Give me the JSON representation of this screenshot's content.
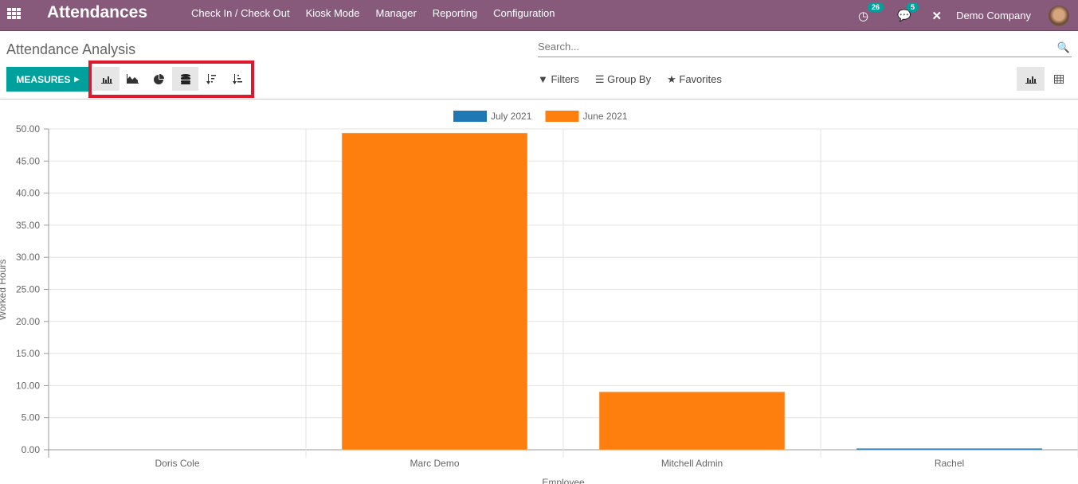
{
  "navbar": {
    "app_title": "Attendances",
    "menu": [
      "Check In / Check Out",
      "Kiosk Mode",
      "Manager",
      "Reporting",
      "Configuration"
    ],
    "activity_count": "26",
    "message_count": "5",
    "company": "Demo Company"
  },
  "control_panel": {
    "breadcrumb": "Attendance Analysis",
    "search_placeholder": "Search...",
    "measures_label": "MEASURES",
    "filters_label": "Filters",
    "groupby_label": "Group By",
    "favorites_label": "Favorites"
  },
  "colors": {
    "navbar": "#875a7b",
    "primary": "#00a09d",
    "highlight": "#e0182d"
  },
  "chart_data": {
    "type": "bar",
    "stacked": true,
    "categories": [
      "Doris Cole",
      "Marc Demo",
      "Mitchell Admin",
      "Rachel"
    ],
    "series": [
      {
        "name": "July 2021",
        "color": "#1f77b4",
        "values": [
          0,
          0,
          0,
          0.1
        ]
      },
      {
        "name": "June 2021",
        "color": "#ff7f0e",
        "values": [
          0,
          49.35,
          9.0,
          0
        ]
      }
    ],
    "xlabel": "Employee",
    "ylabel": "Worked Hours",
    "ylim": [
      0,
      50
    ],
    "yticks": [
      "0.00",
      "5.00",
      "10.00",
      "15.00",
      "20.00",
      "25.00",
      "30.00",
      "35.00",
      "40.00",
      "45.00",
      "50.00"
    ],
    "grid": true,
    "legend": "top-center"
  }
}
